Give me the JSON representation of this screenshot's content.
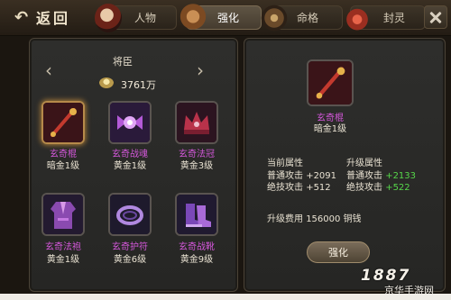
{
  "topbar": {
    "back_label": "返回",
    "tabs": [
      {
        "label": "人物",
        "icon": "character-portrait-icon",
        "active": false
      },
      {
        "label": "强化",
        "icon": "hammer-icon",
        "active": true
      },
      {
        "label": "命格",
        "icon": "destiny-compass-icon",
        "active": false
      },
      {
        "label": "封灵",
        "icon": "spirit-seal-icon",
        "active": false
      }
    ]
  },
  "left": {
    "title": "将臣",
    "currency": "3761万",
    "items": [
      {
        "name": "玄奇棍",
        "level": "暗金1级",
        "icon": "staff-weapon-icon",
        "selected": true,
        "rarity_color": "#d257d8"
      },
      {
        "name": "玄奇战魂",
        "level": "黄金1级",
        "icon": "battle-soul-orb-icon",
        "selected": false
      },
      {
        "name": "玄奇法冠",
        "level": "黄金3级",
        "icon": "crown-icon",
        "selected": false
      },
      {
        "name": "玄奇法袍",
        "level": "黄金1级",
        "icon": "robe-armor-icon",
        "selected": false
      },
      {
        "name": "玄奇护符",
        "level": "黄金6级",
        "icon": "ring-amulet-icon",
        "selected": false
      },
      {
        "name": "玄奇战靴",
        "level": "黄金9级",
        "icon": "boots-icon",
        "selected": false
      }
    ]
  },
  "right": {
    "selected_name": "玄奇棍",
    "selected_level": "暗金1级",
    "current_header": "当前属性",
    "upgrade_header": "升级属性",
    "current": [
      {
        "label": "普通攻击",
        "value": "+2091"
      },
      {
        "label": "绝技攻击",
        "value": "+512"
      }
    ],
    "upgrade": [
      {
        "label": "普通攻击",
        "value": "+2133"
      },
      {
        "label": "绝技攻击",
        "value": "+522"
      }
    ],
    "cost_label": "升级费用",
    "cost_value": "156000",
    "cost_unit": "铜钱",
    "button_label": "强化"
  },
  "watermark": {
    "number": "1887",
    "brand": "京华手游网"
  },
  "colors": {
    "rare_name": "#d257d8",
    "bonus_green": "#56d64a",
    "selected_border": "#b68a4a"
  }
}
